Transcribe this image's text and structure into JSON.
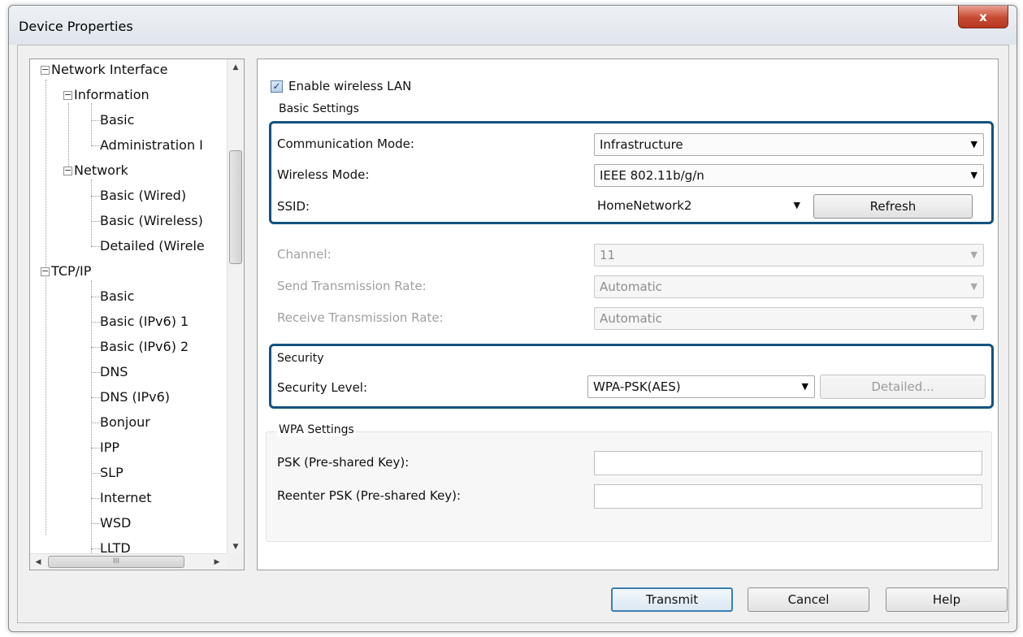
{
  "window": {
    "title": "Device Properties",
    "close_glyph": "x"
  },
  "tree": {
    "items": [
      {
        "label": "Network Interface"
      },
      {
        "label": "Information"
      },
      {
        "label": "Basic"
      },
      {
        "label": "Administration I"
      },
      {
        "label": "Network"
      },
      {
        "label": "Basic (Wired)"
      },
      {
        "label": "Basic (Wireless)"
      },
      {
        "label": "Detailed (Wirele"
      },
      {
        "label": "TCP/IP"
      },
      {
        "label": "Basic"
      },
      {
        "label": "Basic (IPv6) 1"
      },
      {
        "label": "Basic (IPv6) 2"
      },
      {
        "label": "DNS"
      },
      {
        "label": "DNS (IPv6)"
      },
      {
        "label": "Bonjour"
      },
      {
        "label": "IPP"
      },
      {
        "label": "SLP"
      },
      {
        "label": "Internet"
      },
      {
        "label": "WSD"
      },
      {
        "label": "LLTD"
      }
    ],
    "hscroll_grip": "III"
  },
  "settings": {
    "enable_wireless_label": "Enable wireless LAN",
    "enable_wireless_checked": true,
    "basic_settings_heading": "Basic Settings",
    "communication_mode_label": "Communication Mode:",
    "communication_mode_value": "Infrastructure",
    "wireless_mode_label": "Wireless Mode:",
    "wireless_mode_value": "IEEE 802.11b/g/n",
    "ssid_label": "SSID:",
    "ssid_value": "HomeNetwork2",
    "refresh_label": "Refresh",
    "channel_label": "Channel:",
    "channel_value": "11",
    "send_rate_label": "Send Transmission Rate:",
    "send_rate_value": "Automatic",
    "receive_rate_label": "Receive Transmission Rate:",
    "receive_rate_value": "Automatic",
    "security_heading": "Security",
    "security_level_label": "Security Level:",
    "security_level_value": "WPA-PSK(AES)",
    "detailed_label": "Detailed...",
    "wpa_heading": "WPA Settings",
    "psk_label": "PSK (Pre-shared Key):",
    "psk_value": "",
    "reenter_psk_label": "Reenter PSK (Pre-shared Key):",
    "reenter_psk_value": ""
  },
  "footer": {
    "transmit_label": "Transmit",
    "cancel_label": "Cancel",
    "help_label": "Help"
  },
  "colors": {
    "highlight_border": "#14527f",
    "close_button": "#c84a34"
  }
}
